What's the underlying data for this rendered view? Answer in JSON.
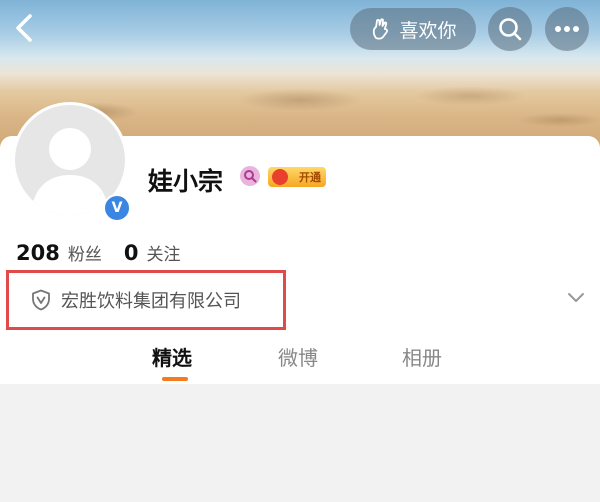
{
  "header": {
    "like_label": "喜欢你"
  },
  "profile": {
    "username": "娃小宗",
    "verified_badge": "V",
    "vip_label": "开通",
    "followers_count": "208",
    "followers_label": "粉丝",
    "following_count": "0",
    "following_label": "关注",
    "company": "宏胜饮料集团有限公司"
  },
  "tabs": [
    {
      "label": "精选",
      "active": true
    },
    {
      "label": "微博",
      "active": false
    },
    {
      "label": "相册",
      "active": false
    }
  ],
  "colors": {
    "accent": "#f47b20",
    "highlight_box": "#e04a4a",
    "verified": "#3b86e3"
  },
  "icons": [
    "back-arrow-icon",
    "like-hand-icon",
    "search-icon",
    "more-icon",
    "search-badge-icon",
    "vip-crown-icon",
    "shield-icon",
    "chevron-down-icon"
  ]
}
